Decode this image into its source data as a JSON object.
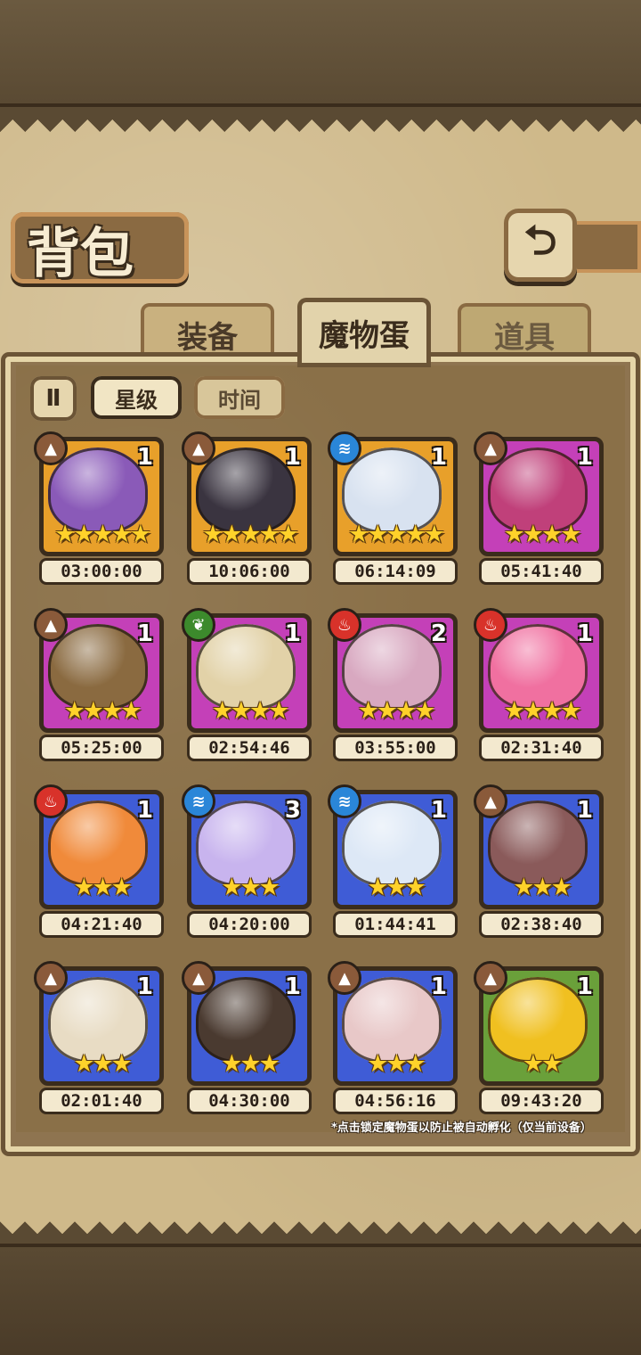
{
  "title": "背包",
  "back_icon": "back-arrow-icon",
  "tabs": [
    {
      "label": "装备",
      "state": "inactive"
    },
    {
      "label": "魔物蛋",
      "state": "active"
    },
    {
      "label": "道具",
      "state": "faded"
    }
  ],
  "sort_toggle": {
    "glyph": "Ⅱ",
    "icon": "sort-order-icon"
  },
  "filters": [
    {
      "label": "星级",
      "active": true
    },
    {
      "label": "时间",
      "active": false
    }
  ],
  "colors": {
    "frame_gold": "#e8a02a",
    "frame_purple": "#c440b8",
    "frame_blue": "#3f5cd6",
    "frame_green": "#6aa03a",
    "element_earth": "#8a5a3a",
    "element_water": "#2a86d8",
    "element_fire": "#d8322a",
    "element_wood": "#3c8a2c"
  },
  "eggs": [
    {
      "count": "1",
      "stars": 5,
      "time": "03:00:00",
      "element": "earth",
      "rarity": "gold",
      "art": "#8a5ab8"
    },
    {
      "count": "1",
      "stars": 5,
      "time": "10:06:00",
      "element": "earth",
      "rarity": "gold",
      "art": "#3a3440"
    },
    {
      "count": "1",
      "stars": 5,
      "time": "06:14:09",
      "element": "water",
      "rarity": "gold",
      "art": "#d8e2f0"
    },
    {
      "count": "1",
      "stars": 4,
      "time": "05:41:40",
      "element": "earth",
      "rarity": "purple",
      "art": "#c0407a"
    },
    {
      "count": "1",
      "stars": 4,
      "time": "05:25:00",
      "element": "earth",
      "rarity": "purple",
      "art": "#8a6a40"
    },
    {
      "count": "1",
      "stars": 4,
      "time": "02:54:46",
      "element": "wood",
      "rarity": "purple",
      "art": "#e2d2a8"
    },
    {
      "count": "2",
      "stars": 4,
      "time": "03:55:00",
      "element": "fire",
      "rarity": "purple",
      "art": "#d8a8c0"
    },
    {
      "count": "1",
      "stars": 4,
      "time": "02:31:40",
      "element": "fire",
      "rarity": "purple",
      "art": "#f070a0"
    },
    {
      "count": "1",
      "stars": 3,
      "time": "04:21:40",
      "element": "fire",
      "rarity": "blue",
      "art": "#f08a3a"
    },
    {
      "count": "3",
      "stars": 3,
      "time": "04:20:00",
      "element": "water",
      "rarity": "blue",
      "art": "#c8b4ee"
    },
    {
      "count": "1",
      "stars": 3,
      "time": "01:44:41",
      "element": "water",
      "rarity": "blue",
      "art": "#dde8f6"
    },
    {
      "count": "1",
      "stars": 3,
      "time": "02:38:40",
      "element": "earth",
      "rarity": "blue",
      "art": "#8a5a5a"
    },
    {
      "count": "1",
      "stars": 3,
      "time": "02:01:40",
      "element": "earth",
      "rarity": "blue",
      "art": "#e8dcc4"
    },
    {
      "count": "1",
      "stars": 3,
      "time": "04:30:00",
      "element": "earth",
      "rarity": "blue",
      "art": "#4a3a30"
    },
    {
      "count": "1",
      "stars": 3,
      "time": "04:56:16",
      "element": "earth",
      "rarity": "blue",
      "art": "#e8c8c8"
    },
    {
      "count": "1",
      "stars": 2,
      "time": "09:43:20",
      "element": "earth",
      "rarity": "green",
      "art": "#f0c020"
    }
  ],
  "footnote": "*点击锁定魔物蛋以防止被自动孵化（仅当前设备）"
}
